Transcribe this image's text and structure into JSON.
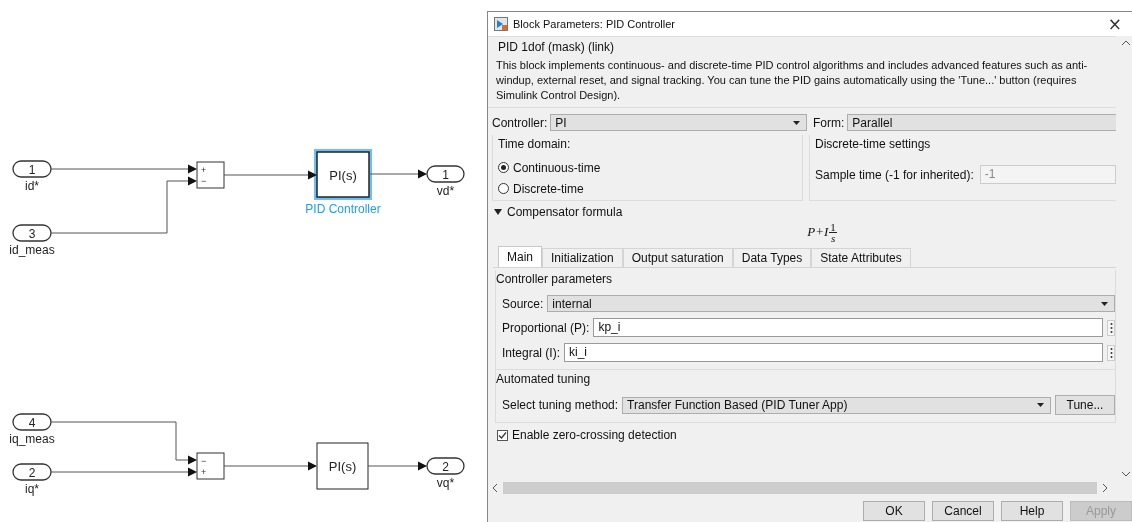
{
  "diagram": {
    "blocks": [
      {
        "kind": "inport",
        "number": "1",
        "label": "id*"
      },
      {
        "kind": "inport",
        "number": "3",
        "label": "id_meas"
      },
      {
        "kind": "sum",
        "signs": [
          "+",
          "−"
        ]
      },
      {
        "kind": "pid",
        "text": "PI(s)",
        "label": "PID Controller",
        "selected": true
      },
      {
        "kind": "outport",
        "number": "1",
        "label": "vd*"
      },
      {
        "kind": "inport",
        "number": "4",
        "label": "iq_meas"
      },
      {
        "kind": "inport",
        "number": "2",
        "label": "iq*"
      },
      {
        "kind": "sum",
        "signs": [
          "−",
          "+"
        ]
      },
      {
        "kind": "pid",
        "text": "PI(s)",
        "selected": false
      },
      {
        "kind": "outport",
        "number": "2",
        "label": "vq*"
      }
    ]
  },
  "dialog": {
    "title": "Block Parameters: PID Controller",
    "close": "×",
    "header": "PID 1dof (mask) (link)",
    "description": "This block implements continuous- and discrete-time PID control algorithms and includes advanced features such as anti-windup, external reset, and signal tracking. You can tune the PID gains automatically using the 'Tune...' button (requires Simulink Control Design).",
    "controller": {
      "label": "Controller:",
      "value": "PI"
    },
    "form": {
      "label": "Form:",
      "value": "Parallel"
    },
    "time_domain": {
      "title": "Time domain:",
      "options": [
        {
          "label": "Continuous-time",
          "selected": true
        },
        {
          "label": "Discrete-time",
          "selected": false
        }
      ]
    },
    "discrete_settings": {
      "title": "Discrete-time settings",
      "label": "Sample time (-1 for inherited):",
      "value": "-1",
      "disabled": true
    },
    "compensator": {
      "label": "Compensator formula",
      "expanded": true,
      "formula": "P+I",
      "numerator": "1",
      "denominator": "s"
    },
    "tabs": [
      {
        "label": "Main",
        "selected": true
      },
      {
        "label": "Initialization",
        "selected": false
      },
      {
        "label": "Output saturation",
        "selected": false
      },
      {
        "label": "Data Types",
        "selected": false
      },
      {
        "label": "State Attributes",
        "selected": false
      }
    ],
    "controller_parameters": {
      "title": "Controller parameters",
      "source": {
        "label": "Source:",
        "value": "internal"
      },
      "fields": [
        {
          "label": "Proportional (P):",
          "value": "kp_i"
        },
        {
          "label": "Integral (I):",
          "value": "ki_i"
        }
      ]
    },
    "automated_tuning": {
      "title": "Automated tuning",
      "label": "Select tuning method:",
      "value": "Transfer Function Based (PID Tuner App)",
      "button": "Tune..."
    },
    "zero_crossing": {
      "label": "Enable zero-crossing detection",
      "checked": true
    },
    "buttons": [
      {
        "label": "OK",
        "disabled": false
      },
      {
        "label": "Cancel",
        "disabled": false
      },
      {
        "label": "Help",
        "disabled": false
      },
      {
        "label": "Apply",
        "disabled": true
      }
    ]
  }
}
